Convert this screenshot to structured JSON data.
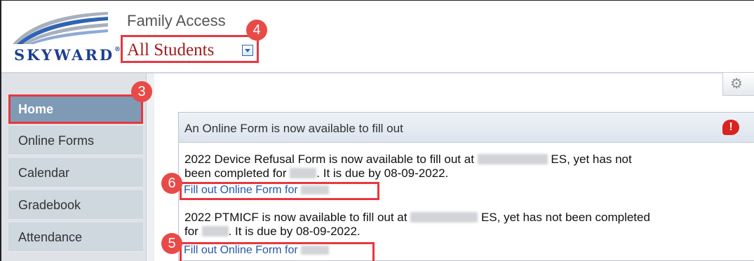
{
  "header": {
    "logo_text": "SKYWARD",
    "logo_mark": "®",
    "app_title": "Family Access",
    "student_selector": "All Students",
    "dropdown_icon": "dropdown-arrow-icon"
  },
  "badges": {
    "b3": "3",
    "b4": "4",
    "b5": "5",
    "b6": "6"
  },
  "sidebar": {
    "items": [
      {
        "label": "Home"
      },
      {
        "label": "Online Forms"
      },
      {
        "label": "Calendar"
      },
      {
        "label": "Gradebook"
      },
      {
        "label": "Attendance"
      }
    ]
  },
  "toolbar": {
    "gear_icon": "⚙"
  },
  "panel": {
    "title": "An Online Form is now available to fill out",
    "alert_glyph": "!",
    "messages": [
      {
        "line1_a": "2022 Device Refusal Form is now available to fill out at",
        "line1_b": "ES, yet has not",
        "line2_a": "been completed for",
        "line2_b": ".  It is due by 08-09-2022.",
        "link": "Fill out Online Form for"
      },
      {
        "line1_a": "2022 PTMICF is now available to fill out at",
        "line1_b": "ES, yet has not been completed",
        "line2_a": "for",
        "line2_b": ".  It is due by 08-09-2022.",
        "link": "Fill out Online Form for"
      }
    ]
  },
  "colors": {
    "accent_red": "#e8373f",
    "nav_active": "#7f9ab5",
    "link": "#2457a8",
    "brand_blue": "#1c3f8f"
  }
}
